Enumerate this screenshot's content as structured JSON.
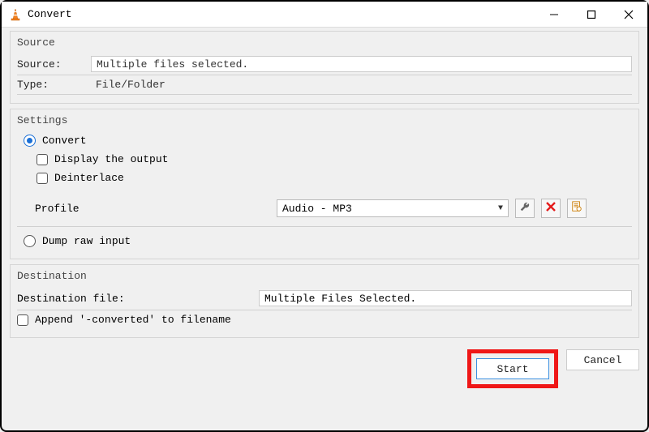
{
  "window": {
    "title": "Convert"
  },
  "source": {
    "group_label": "Source",
    "label": "Source:",
    "value": "Multiple files selected.",
    "type_label": "Type:",
    "type_value": "File/Folder"
  },
  "settings": {
    "group_label": "Settings",
    "convert_label": "Convert",
    "display_output_label": "Display the output",
    "deinterlace_label": "Deinterlace",
    "profile_label": "Profile",
    "profile_value": "Audio - MP3",
    "dump_raw_label": "Dump raw input"
  },
  "destination": {
    "group_label": "Destination",
    "label": "Destination file:",
    "value": "Multiple Files Selected.",
    "append_label": "Append '-converted' to filename"
  },
  "buttons": {
    "start": "Start",
    "cancel": "Cancel"
  }
}
